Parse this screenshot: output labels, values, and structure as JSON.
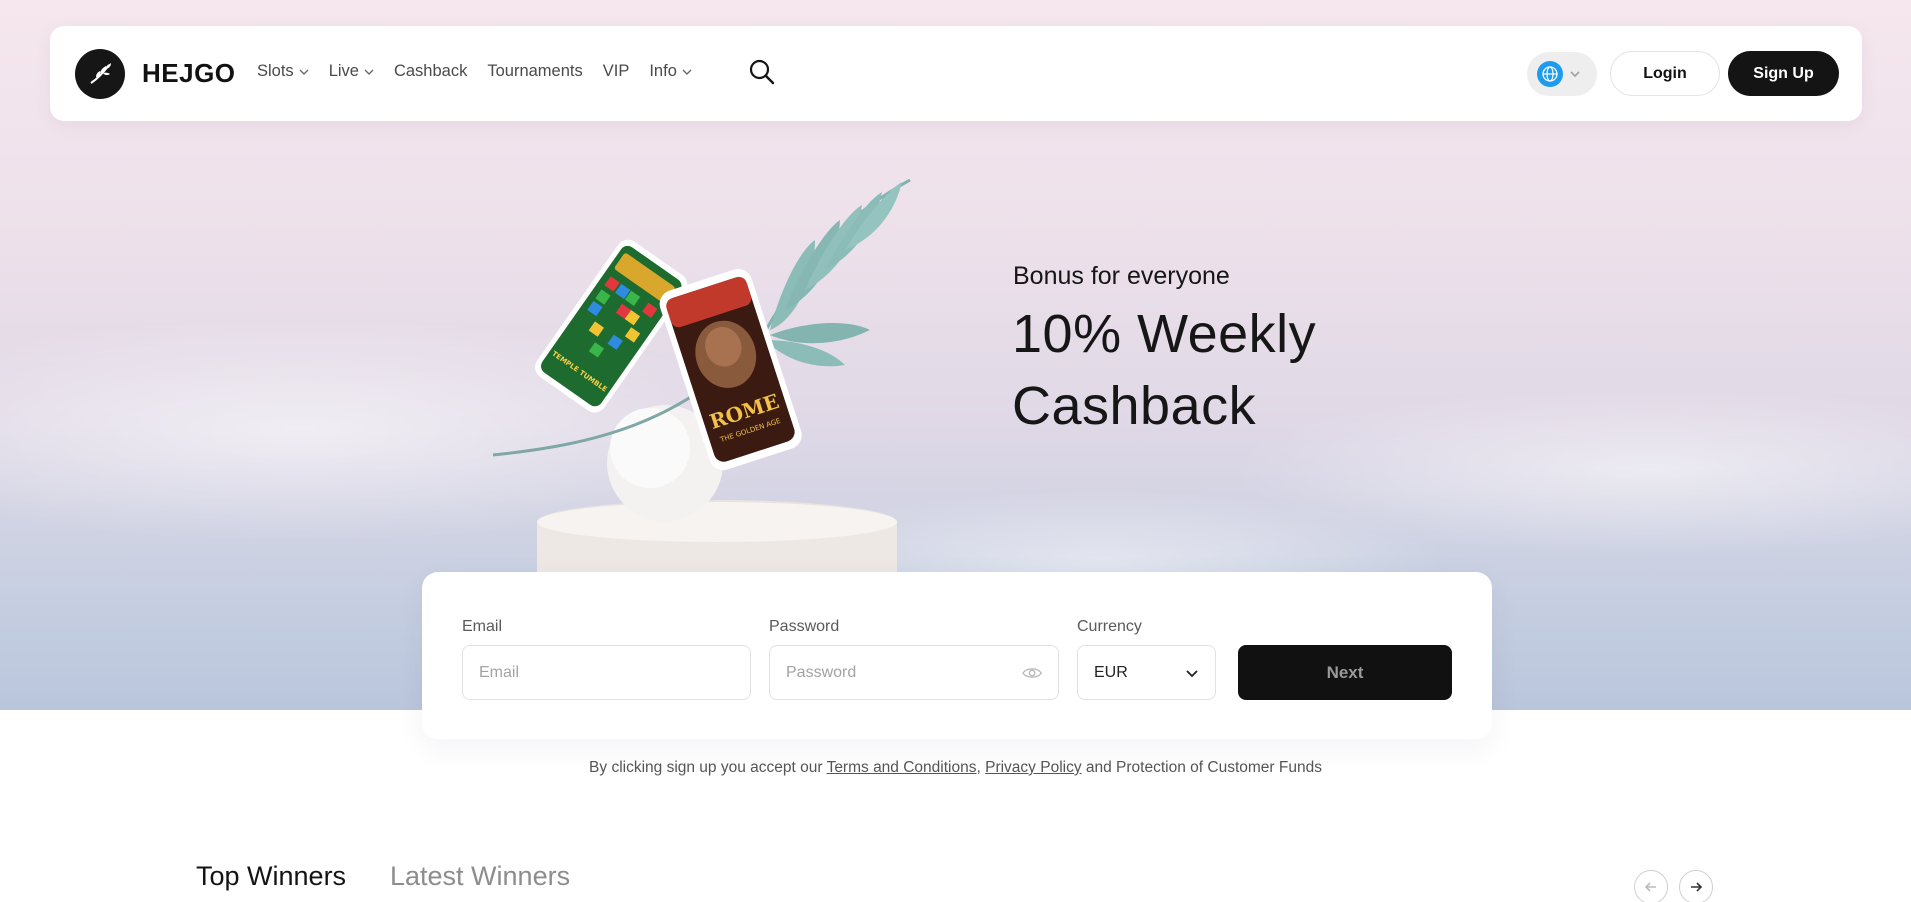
{
  "brand": {
    "name": "HEJGO"
  },
  "nav": {
    "items": [
      {
        "label": "Slots",
        "has_dropdown": true
      },
      {
        "label": "Live",
        "has_dropdown": true
      },
      {
        "label": "Cashback",
        "has_dropdown": false
      },
      {
        "label": "Tournaments",
        "has_dropdown": false
      },
      {
        "label": "VIP",
        "has_dropdown": false
      },
      {
        "label": "Info",
        "has_dropdown": true
      }
    ],
    "search_icon": "search-icon",
    "language_icon": "globe-icon",
    "login_label": "Login",
    "signup_label": "Sign Up"
  },
  "hero": {
    "subtitle": "Bonus for everyone",
    "title": "10% Weekly Cashback",
    "phone_game_1": "TEMPLE TUMBLE",
    "phone_game_2_title": "ROME",
    "phone_game_2_sub": "THE GOLDEN AGE"
  },
  "signup_form": {
    "email_label": "Email",
    "email_placeholder": "Email",
    "password_label": "Password",
    "password_placeholder": "Password",
    "currency_label": "Currency",
    "currency_value": "EUR",
    "next_label": "Next"
  },
  "legal": {
    "prefix": "By clicking sign up you accept our ",
    "terms_link": "Terms and Conditions",
    "comma": ", ",
    "privacy_link": "Privacy Policy",
    "suffix": " and Protection of Customer Funds"
  },
  "winners": {
    "tab_top": "Top Winners",
    "tab_latest": "Latest Winners"
  },
  "colors": {
    "primary_dark": "#141414",
    "globe_blue": "#1e9bef",
    "leaf_teal": "#7fb2ae"
  }
}
